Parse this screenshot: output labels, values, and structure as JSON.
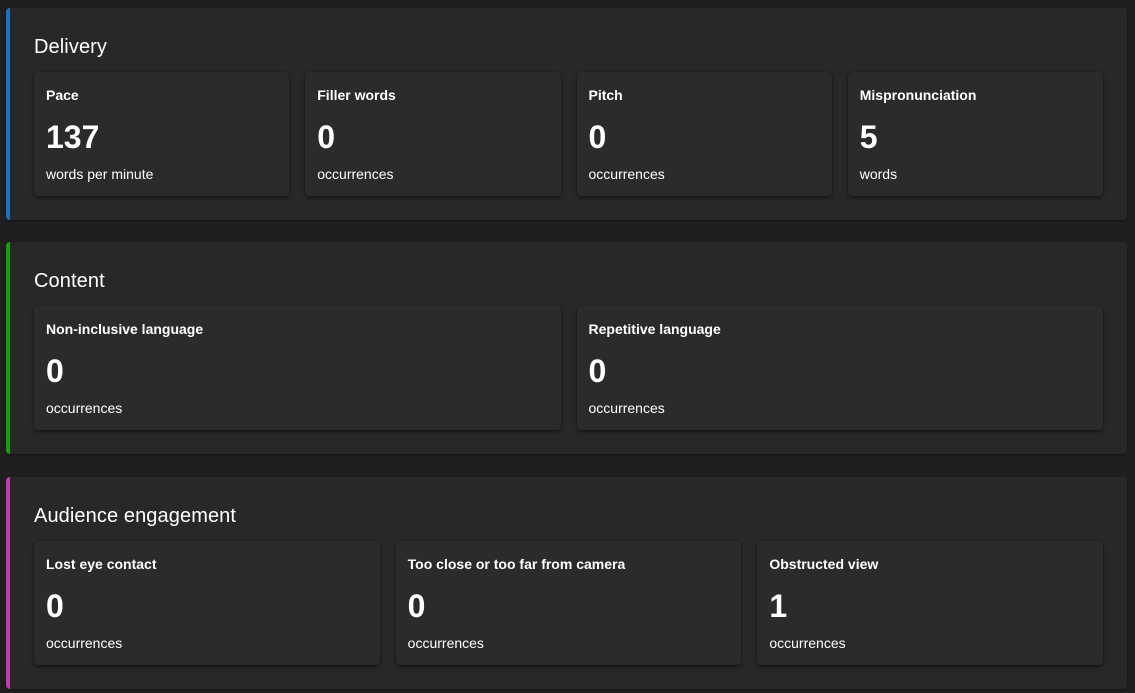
{
  "sections": [
    {
      "title": "Delivery",
      "accent": "#1f6fc4",
      "cards": [
        {
          "label": "Pace",
          "value": "137",
          "unit": "words per minute"
        },
        {
          "label": "Filler words",
          "value": "0",
          "unit": "occurrences"
        },
        {
          "label": "Pitch",
          "value": "0",
          "unit": "occurrences"
        },
        {
          "label": "Mispronunciation",
          "value": "5",
          "unit": "words"
        }
      ]
    },
    {
      "title": "Content",
      "accent": "#13a10e",
      "cards": [
        {
          "label": "Non-inclusive language",
          "value": "0",
          "unit": "occurrences"
        },
        {
          "label": "Repetitive language",
          "value": "0",
          "unit": "occurrences"
        }
      ]
    },
    {
      "title": "Audience engagement",
      "accent": "#c239b3",
      "cards": [
        {
          "label": "Lost eye contact",
          "value": "0",
          "unit": "occurrences"
        },
        {
          "label": "Too close or too far from camera",
          "value": "0",
          "unit": "occurrences"
        },
        {
          "label": "Obstructed view",
          "value": "1",
          "unit": "occurrences"
        }
      ]
    }
  ]
}
